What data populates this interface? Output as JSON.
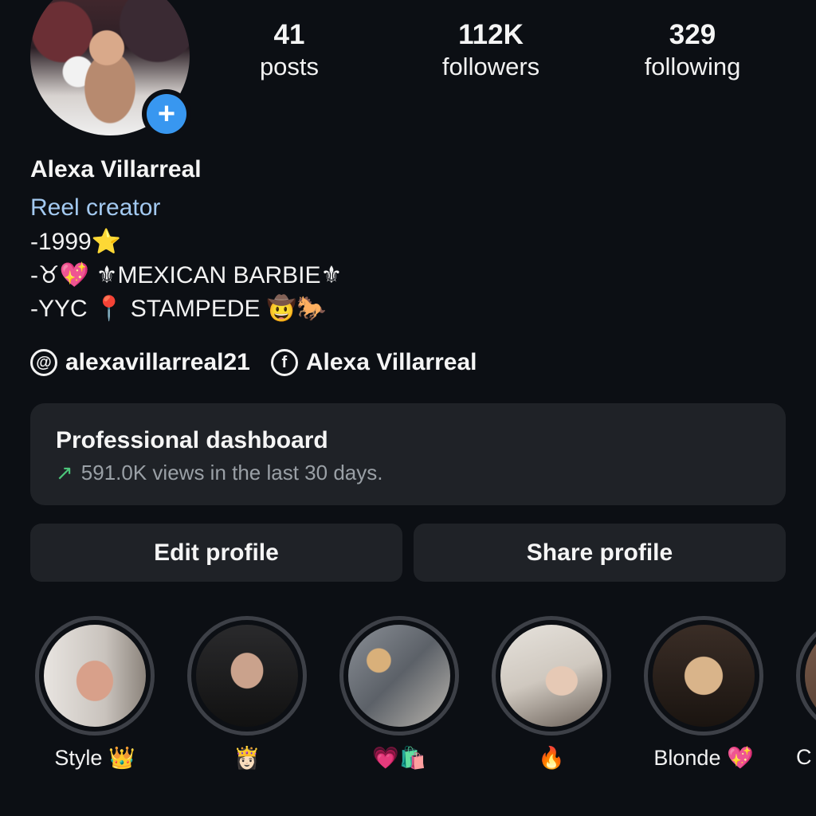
{
  "profile": {
    "name": "Alexa Villarreal",
    "category": "Reel creator",
    "bio": [
      "-1999⭐",
      "-♉💖 ⚜MEXICAN BARBIE⚜",
      "-YYC 📍 STAMPEDE 🤠🐎"
    ],
    "add_story_symbol": "+"
  },
  "stats": {
    "posts": {
      "value": "41",
      "label": "posts"
    },
    "followers": {
      "value": "112K",
      "label": "followers"
    },
    "following": {
      "value": "329",
      "label": "following"
    }
  },
  "links": {
    "threads": {
      "text": "alexavillarreal21",
      "icon": "threads-icon",
      "glyph": "@"
    },
    "facebook": {
      "text": "Alexa Villarreal",
      "icon": "facebook-icon",
      "glyph": "f"
    }
  },
  "dashboard": {
    "title": "Professional dashboard",
    "subtitle": "591.0K views in the last 30 days.",
    "trend_glyph": "↗"
  },
  "buttons": {
    "edit": "Edit profile",
    "share": "Share profile"
  },
  "highlights": [
    {
      "caption": "Style 👑"
    },
    {
      "caption": "👸🏻"
    },
    {
      "caption": "💗🛍️"
    },
    {
      "caption": "🔥"
    },
    {
      "caption": "Blonde 💖"
    },
    {
      "caption": "C"
    }
  ],
  "colors": {
    "background": "#0c0f14",
    "category": "#a3c9f0",
    "accent": "#3897f0",
    "trend": "#4cc57a",
    "card": "#1f2227"
  }
}
